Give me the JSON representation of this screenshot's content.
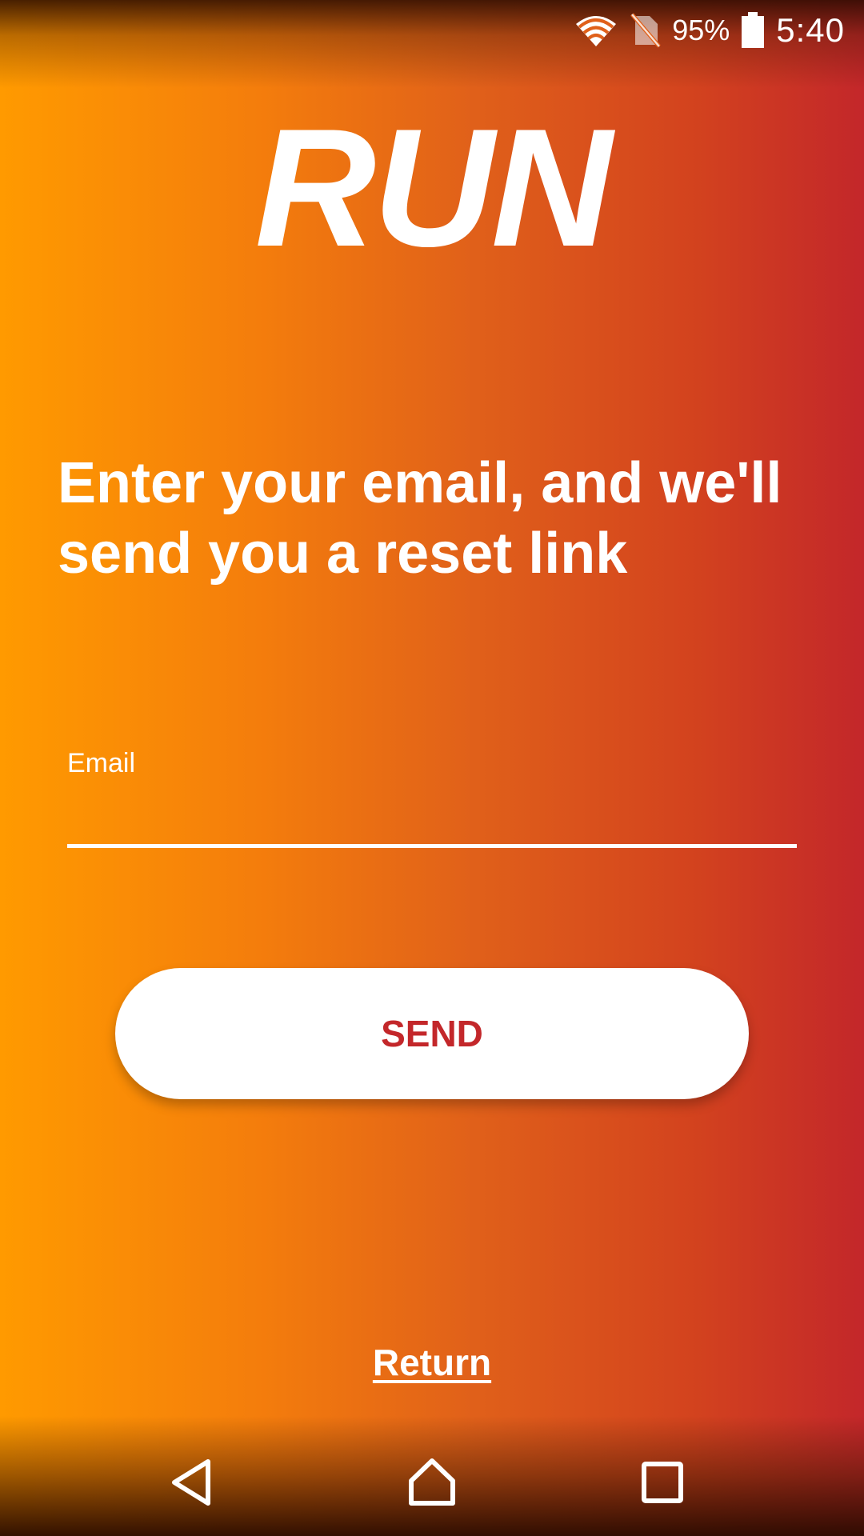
{
  "status_bar": {
    "battery_percent": "95%",
    "time": "5:40",
    "icons": [
      "wifi-icon",
      "no-sim-icon",
      "battery-icon"
    ]
  },
  "app": {
    "logo": "RUN"
  },
  "form": {
    "heading": "Enter your email, and we'll send you a reset link",
    "email_label": "Email",
    "email_value": "",
    "send_label": "SEND",
    "return_label": "Return"
  },
  "nav_bar": {
    "icons": [
      "back-icon",
      "home-icon",
      "recents-icon"
    ]
  },
  "colors": {
    "gradient_start": "#ff9a00",
    "gradient_end": "#c3272a",
    "button_text": "#c3272a",
    "button_bg": "#ffffff"
  }
}
